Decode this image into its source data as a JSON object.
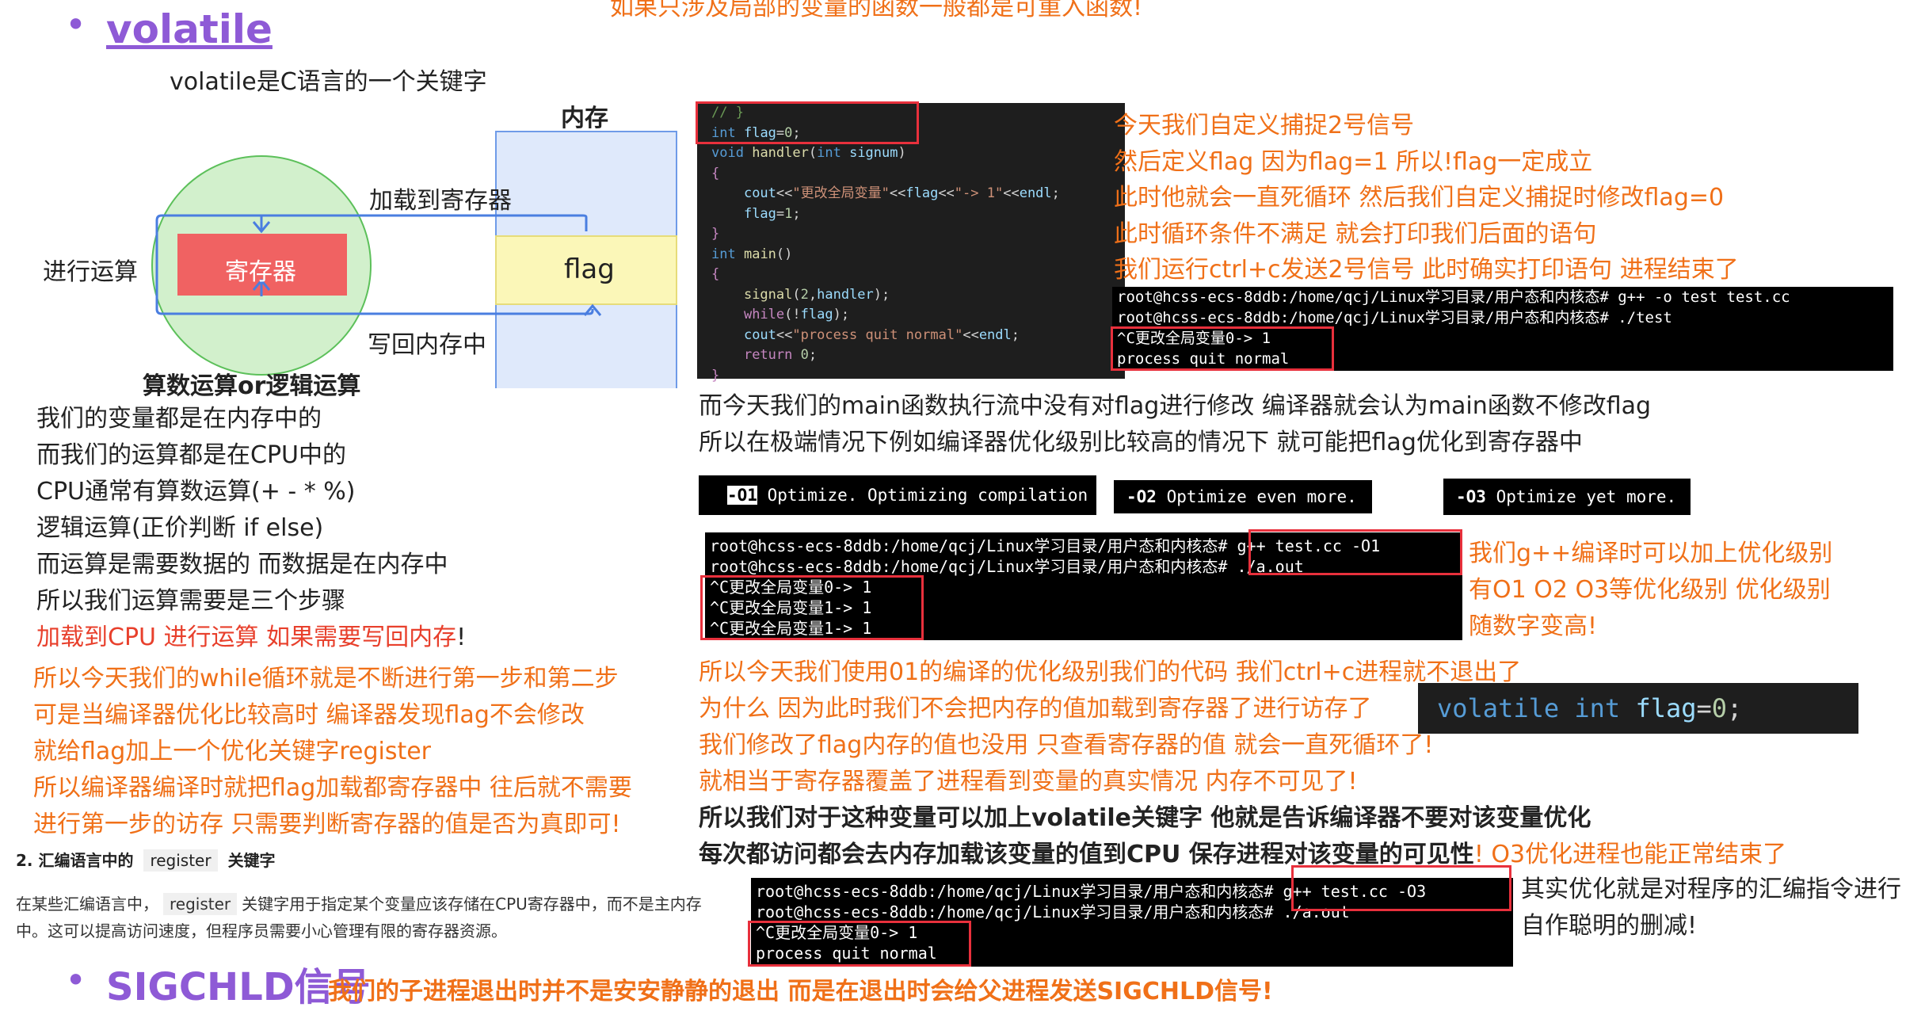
{
  "top_cut_text": "如果只涉及局部的变量的函数一般都是可重入函数!",
  "heading": {
    "bullet": "•",
    "title": "volatile"
  },
  "intro": "volatile是C语言的一个关键字",
  "diagram": {
    "memory_label": "内存",
    "register_label": "寄存器",
    "flag_label": "flag",
    "load_label": "加载到寄存器",
    "compute_label": "进行运算",
    "writeback_label": "写回内存中",
    "caption": "算数运算or逻辑运算"
  },
  "left_lines": [
    "我们的变量都是在内存中的",
    "而我们的运算都是在CPU中的",
    "CPU通常有算数运算(+ - * %)",
    "逻辑运算(正价判断 if else)",
    "而运算是需要数据的 而数据是在内存中",
    "所以我们运算需要是三个步骤"
  ],
  "left_red_line": "加载到CPU 进行运算 如果需要写回内存",
  "left_red_suffix": "!",
  "left_orange_lines": [
    "所以今天我们的while循环就是不断进行第一步和第二步",
    "可是当编译器优化比较高时 编译器发现flag不会修改",
    "就给flag加上一个优化关键字register",
    "所以编译器编译时就把flag加载都寄存器中 往后就不需要",
    "进行第一步的访存 只需要判断寄存器的值是否为真即可!"
  ],
  "asm_note": {
    "heading_num": "2. 汇编语言中的",
    "heading_code": "register",
    "heading_end": "关键字",
    "para_a": "在某些汇编语言中，",
    "para_code": "register",
    "para_b": "关键字用于指定某个变量应该存储在CPU寄存器中，而不是主内存",
    "para_c": "中。这可以提高访问速度，但程序员需要小心管理有限的寄存器资源。"
  },
  "code": {
    "lines": [
      "// }",
      "int flag=0;",
      "void handler(int signum)",
      "{",
      "    cout<<\"更改全局变量\"<<flag<<\"-> 1\"<<endl;",
      "    flag=1;",
      "}",
      "int main()",
      "{",
      "    signal(2,handler);",
      "    while(!flag);",
      "    cout<<\"process quit normal\"<<endl;",
      "    return 0;",
      "}"
    ]
  },
  "right_orange_lines": [
    "今天我们自定义捕捉2号信号",
    "然后定义flag 因为flag=1 所以!flag一定成立",
    "此时他就会一直死循环 然后我们自定义捕捉时修改flag=0",
    "此时循环条件不满足 就会打印我们后面的语句",
    "我们运行ctrl+c发送2号信号 此时确实打印语句 进程结束了"
  ],
  "term1": [
    "root@hcss-ecs-8ddb:/home/qcj/Linux学习目录/用户态和内核态# g++ -o test test.cc",
    "root@hcss-ecs-8ddb:/home/qcj/Linux学习目录/用户态和内核态# ./test",
    "^C更改全局变量0-> 1",
    "process quit normal"
  ],
  "mid_lines": [
    "而今天我们的main函数执行流中没有对flag进行修改 编译器就会认为main函数不修改flag",
    "所以在极端情况下例如编译器优化级别比较高的情况下 就可能把flag优化到寄存器中"
  ],
  "opt": {
    "o1_flag": "-O1",
    "o1_text": "Optimize.  Optimizing compilation",
    "o2_flag": "-O2",
    "o2_text": "Optimize even more.",
    "o3_flag": "-O3",
    "o3_text": "Optimize yet more."
  },
  "term2": [
    "root@hcss-ecs-8ddb:/home/qcj/Linux学习目录/用户态和内核态# g++  test.cc -O1",
    "root@hcss-ecs-8ddb:/home/qcj/Linux学习目录/用户态和内核态# ./a.out",
    "^C更改全局变量0-> 1",
    "^C更改全局变量1-> 1",
    "^C更改全局变量1-> 1"
  ],
  "opt_note": [
    "我们g++编译时可以加上优化级别",
    "有O1 O2 O3等优化级别 优化级别",
    "随数字变高!"
  ],
  "explain_lines": [
    "所以今天我们使用01的编译的优化级别我们的代码 我们ctrl+c进程就不退出了",
    "为什么 因为此时我们不会把内存的值加载到寄存器了进行访存了",
    "我们修改了flag内存的值也没用 只查看寄存器的值 就会一直死循环了!",
    "就相当于寄存器覆盖了进程看到变量的真实情况 内存不可见了!"
  ],
  "volatile_code": {
    "kw1": "volatile",
    "kw2": "int",
    "var": "flag",
    "eq": "=",
    "num": "0",
    "semi": ";"
  },
  "bold_lines": [
    "所以我们对于这种变量可以加上volatile关键字 他就是告诉编译器不要对该变量优化",
    "每次都访问都会去内存加载该变量的值到CPU 保存进程对该变量的可见性"
  ],
  "o3_note": "!  O3优化进程也能正常结束了",
  "term3": [
    "root@hcss-ecs-8ddb:/home/qcj/Linux学习目录/用户态和内核态# g++  test.cc -O3",
    "root@hcss-ecs-8ddb:/home/qcj/Linux学习目录/用户态和内核态# ./a.out",
    "^C更改全局变量0-> 1",
    "process quit normal"
  ],
  "final_note": [
    "其实优化就是对程序的汇编指令进行",
    "自作聪明的删减!"
  ],
  "bottom": {
    "heading": "SIGCHLD信号",
    "text": "我们的子进程退出时并不是安安静静的退出 而是在退出时会给父进程发送SIGCHLD信号!"
  },
  "colors": {
    "orange": "#f07018",
    "red": "#e8402c",
    "purple": "#8e5ad6",
    "highlight": "#e8303c"
  }
}
